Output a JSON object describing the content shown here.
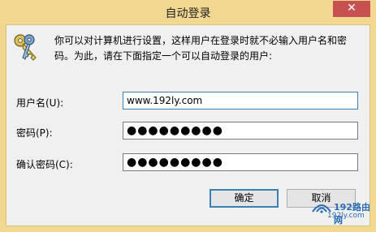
{
  "window": {
    "title": "自动登录",
    "close_glyph": "✕"
  },
  "description": "你可以对计算机进行设置，这样用户在登录时就不必输入用户名和密码。为此，请在下面指定一个可以自动登录的用户:",
  "form": {
    "username_label": "用户名(U):",
    "username_value": "www.192ly.com",
    "password_label": "密码(P):",
    "password_value": "●●●●●●●●●",
    "confirm_label": "确认密码(C):",
    "confirm_value": "●●●●●●●●●"
  },
  "buttons": {
    "ok": "确定",
    "cancel": "取消"
  },
  "watermark": {
    "top": "192路由网",
    "bottom": "192ly.com"
  },
  "colors": {
    "title_bar": "#f2d790",
    "close_button": "#c75050",
    "focus_border": "#3c7fb1"
  }
}
